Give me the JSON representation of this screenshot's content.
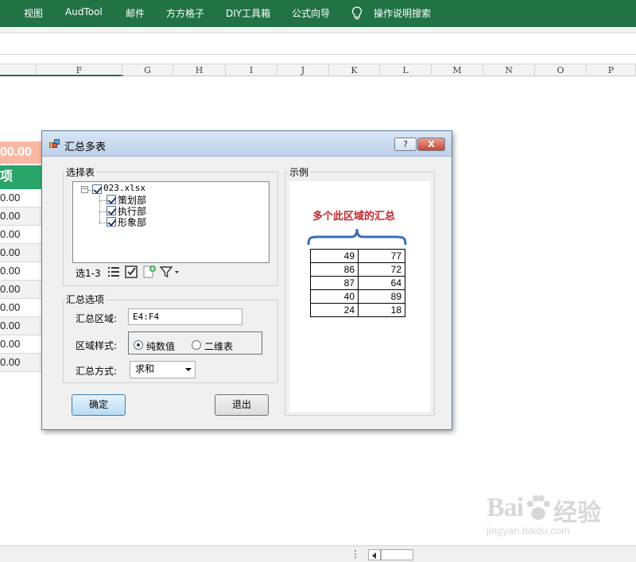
{
  "ribbon": {
    "tabs": [
      "视图",
      "AudTool",
      "邮件",
      "方方格子",
      "DIY工具箱",
      "公式向导"
    ],
    "tell_me": "操作说明搜索"
  },
  "columns": [
    "F",
    "G",
    "H",
    "I",
    "J",
    "K",
    "L",
    "M",
    "N",
    "O",
    "P"
  ],
  "sheet": {
    "header_value": "00.00",
    "header_label": "项",
    "cells": [
      "0.00",
      "0.00",
      "0.00",
      "0.00",
      "0.00",
      "0.00",
      "0.00",
      "0.00",
      "0.00",
      "0.00"
    ]
  },
  "dialog": {
    "title": "汇总多表",
    "help_label": "?",
    "close_label": "X",
    "select_group": "选择表",
    "tree": {
      "file": "023.xlsx",
      "sheets": [
        "策划部",
        "执行部",
        "形象部"
      ]
    },
    "toolbar_text": "选1-3",
    "options_group": "汇总选项",
    "range_label": "汇总区域:",
    "range_value": "E4:F4",
    "style_label": "区域样式:",
    "style_options": [
      "纯数值",
      "二维表"
    ],
    "method_label": "汇总方式:",
    "method_value": "求和",
    "ok_label": "确定",
    "exit_label": "退出",
    "example_group": "示例",
    "example_heading": "多个此区域的汇总",
    "example_rows": [
      [
        "49",
        "77"
      ],
      [
        "86",
        "72"
      ],
      [
        "87",
        "64"
      ],
      [
        "40",
        "89"
      ],
      [
        "24",
        "18"
      ]
    ]
  },
  "watermark": {
    "brand": "Bai",
    "brand_cn": "经验",
    "url": "jingyan.baidu.com"
  },
  "colors": {
    "excel_green": "#217346",
    "sheet_green": "#2aa56a",
    "highlight": "#f9b8a3",
    "example_heading": "#c0282d"
  }
}
